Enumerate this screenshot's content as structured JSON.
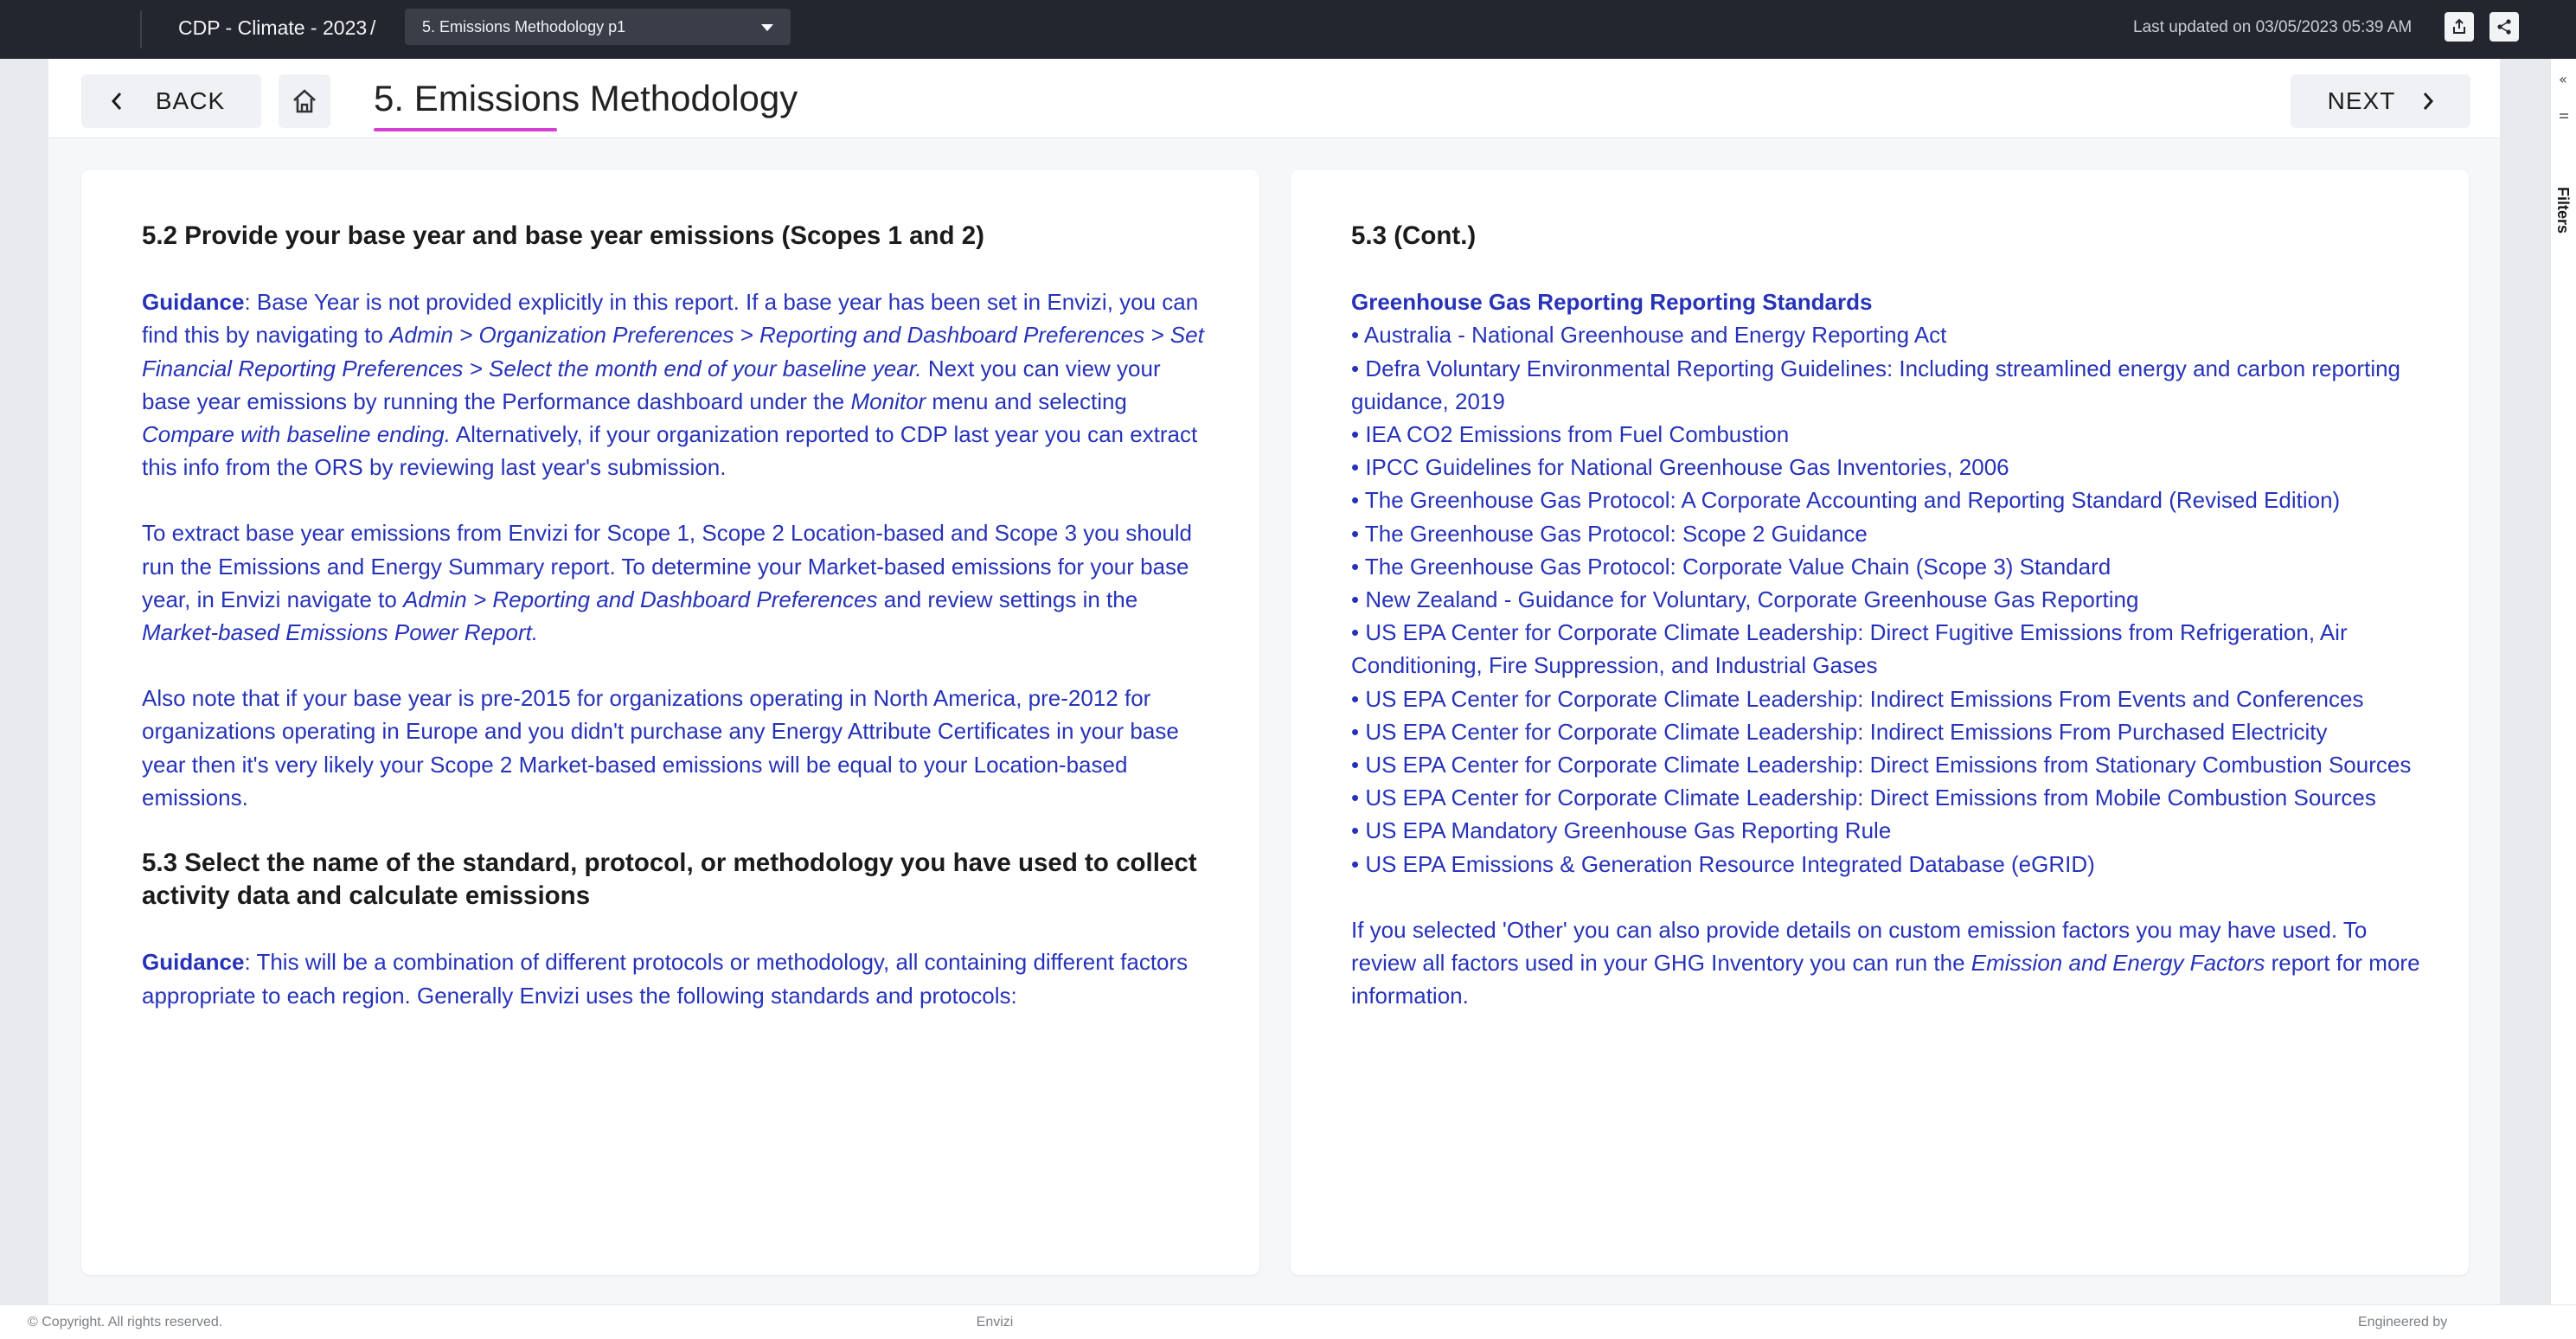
{
  "topbar": {
    "app_title": "CDP - Climate - 2023",
    "separator": "/",
    "page_select_value": "5. Emissions Methodology p1",
    "last_updated": "Last updated on 03/05/2023 05:39 AM",
    "export_icon": "export-icon",
    "share_icon": "share-icon"
  },
  "header": {
    "back_label": "BACK",
    "home_icon": "home-icon",
    "title": "5. Emissions Methodology",
    "next_label": "NEXT",
    "accent_color": "#d63fd3"
  },
  "filters": {
    "label": "Filters",
    "collapse_glyph": "«"
  },
  "left_card": {
    "q52_heading": "5.2 Provide your base year and base year emissions (Scopes 1 and 2)",
    "guidance_label": "Guidance",
    "p1_a": ": Base Year is not provided explicitly in this report. If a base year has been set in Envizi, you can find this by navigating to ",
    "p1_path": "Admin > Organization Preferences > Reporting and Dashboard Preferences > Set Financial Reporting Preferences > Select the month end of your baseline year.",
    "p1_b": " Next you can view your base year emissions by running the Performance dashboard under the ",
    "p1_monitor": "Monitor",
    "p1_c": " menu and selecting ",
    "p1_compare": "Compare with baseline ending.",
    "p1_d": " Alternatively, if your organization reported to CDP last year you can extract this info from the ORS by reviewing last year's submission.",
    "p2_a": "To extract base year emissions from Envizi for Scope 1, Scope 2 Location-based and Scope 3 you should run the Emissions and Energy Summary report. To determine your Market-based emissions for your base year, in Envizi navigate to ",
    "p2_path": "Admin > Reporting and Dashboard Preferences",
    "p2_b": " and review settings in the ",
    "p2_report": "Market-based Emissions Power Report.",
    "p3": "Also note that if your base year is pre-2015 for organizations operating in North America, pre-2012 for organizations operating in Europe and you didn't purchase any Energy Attribute Certificates in your base year then it's very likely your Scope 2 Market-based emissions will be equal to your Location-based emissions.",
    "q53_heading": "5.3 Select the name of the standard, protocol, or methodology you have used to collect activity data and calculate emissions",
    "guidance2_label": "Guidance",
    "p4": ": This will be a combination of different protocols or methodology, all containing different factors appropriate to each region. Generally Envizi uses the following standards and protocols:"
  },
  "right_card": {
    "heading": "5.3 (Cont.)",
    "standards_heading": "Greenhouse Gas Reporting Reporting Standards",
    "standards": [
      "• Australia - National Greenhouse and Energy Reporting Act",
      "• Defra Voluntary Environmental Reporting Guidelines: Including streamlined energy and carbon reporting guidance, 2019",
      "• IEA CO2 Emissions from Fuel Combustion",
      "• IPCC Guidelines for National Greenhouse Gas Inventories, 2006",
      "• The Greenhouse Gas Protocol: A Corporate Accounting and Reporting Standard (Revised Edition)",
      "• The Greenhouse Gas Protocol: Scope 2 Guidance",
      "• The Greenhouse Gas Protocol: Corporate Value Chain (Scope 3) Standard",
      "• New Zealand - Guidance for Voluntary, Corporate Greenhouse Gas Reporting",
      "• US EPA Center for Corporate Climate Leadership: Direct Fugitive Emissions from Refrigeration, Air Conditioning, Fire Suppression, and Industrial Gases",
      "• US EPA Center for Corporate Climate Leadership: Indirect Emissions From Events and Conferences",
      "• US EPA Center for Corporate Climate Leadership: Indirect Emissions From Purchased Electricity",
      "• US EPA Center for Corporate Climate Leadership: Direct Emissions from Stationary Combustion Sources",
      "• US EPA Center for Corporate Climate Leadership: Direct Emissions from Mobile Combustion Sources",
      "• US EPA Mandatory Greenhouse Gas Reporting Rule",
      "• US EPA Emissions & Generation Resource Integrated Database (eGRID)"
    ],
    "other_a": "If you selected 'Other' you can also provide details on custom emission factors you may have used. To review all factors used in your GHG Inventory you can run the ",
    "other_report": "Emission and Energy Factors",
    "other_b": " report for more information."
  },
  "footer": {
    "copyright": "© Copyright. All rights reserved.",
    "brand": "Envizi",
    "engineered": "Engineered by"
  },
  "colors": {
    "topbar": "#23262f",
    "guidance_text": "#2633b8",
    "heading_text": "#1b1b1b"
  }
}
